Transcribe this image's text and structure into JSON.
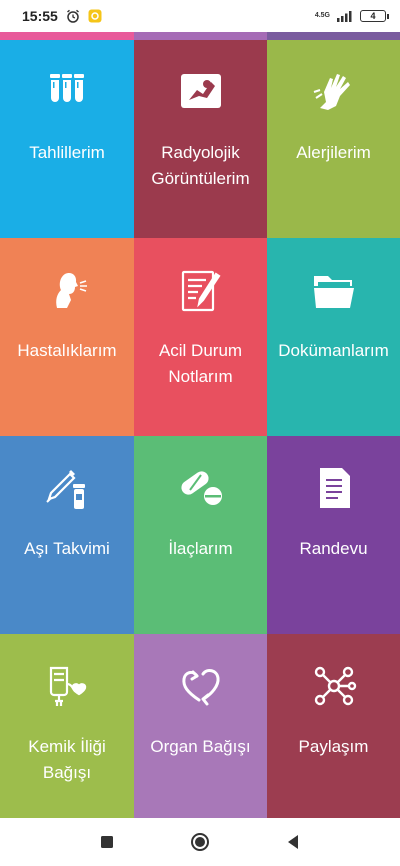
{
  "status_bar": {
    "time": "15:55",
    "network": "4.5G",
    "battery": "4"
  },
  "strip_colors": [
    "#e85a9a",
    "#a56bb5",
    "#7a5c9e"
  ],
  "tiles": [
    {
      "label": "Tahlillerim",
      "icon": "test-tubes-icon",
      "color": "#1aaee6"
    },
    {
      "label": "Radyolojik\nGörüntülerim",
      "icon": "xray-image-icon",
      "color": "#9b3a4d"
    },
    {
      "label": "Alerjilerim",
      "icon": "allergy-glove-icon",
      "color": "#9ab84a"
    },
    {
      "label": "Hastalıklarım",
      "icon": "coughing-person-icon",
      "color": "#f08255"
    },
    {
      "label": "Acil Durum\nNotlarım",
      "icon": "notes-pencil-icon",
      "color": "#e8505f"
    },
    {
      "label": "Dokümanlarım",
      "icon": "folder-icon",
      "color": "#28b5ae"
    },
    {
      "label": "Aşı Takvimi",
      "icon": "syringe-vial-icon",
      "color": "#4a89c8"
    },
    {
      "label": "İlaçlarım",
      "icon": "pills-icon",
      "color": "#5bbd76"
    },
    {
      "label": "Randevu",
      "icon": "document-icon",
      "color": "#7a429c"
    },
    {
      "label": "Kemik İliği Bağışı",
      "icon": "iv-bag-heart-icon",
      "color": "#9dbd4c"
    },
    {
      "label": "Organ Bağışı",
      "icon": "heart-arrow-icon",
      "color": "#a878b8"
    },
    {
      "label": "Paylaşım",
      "icon": "share-network-icon",
      "color": "#9c3d50"
    }
  ],
  "nav": {
    "recents": "square-icon",
    "home": "circle-icon",
    "back": "triangle-back-icon"
  }
}
